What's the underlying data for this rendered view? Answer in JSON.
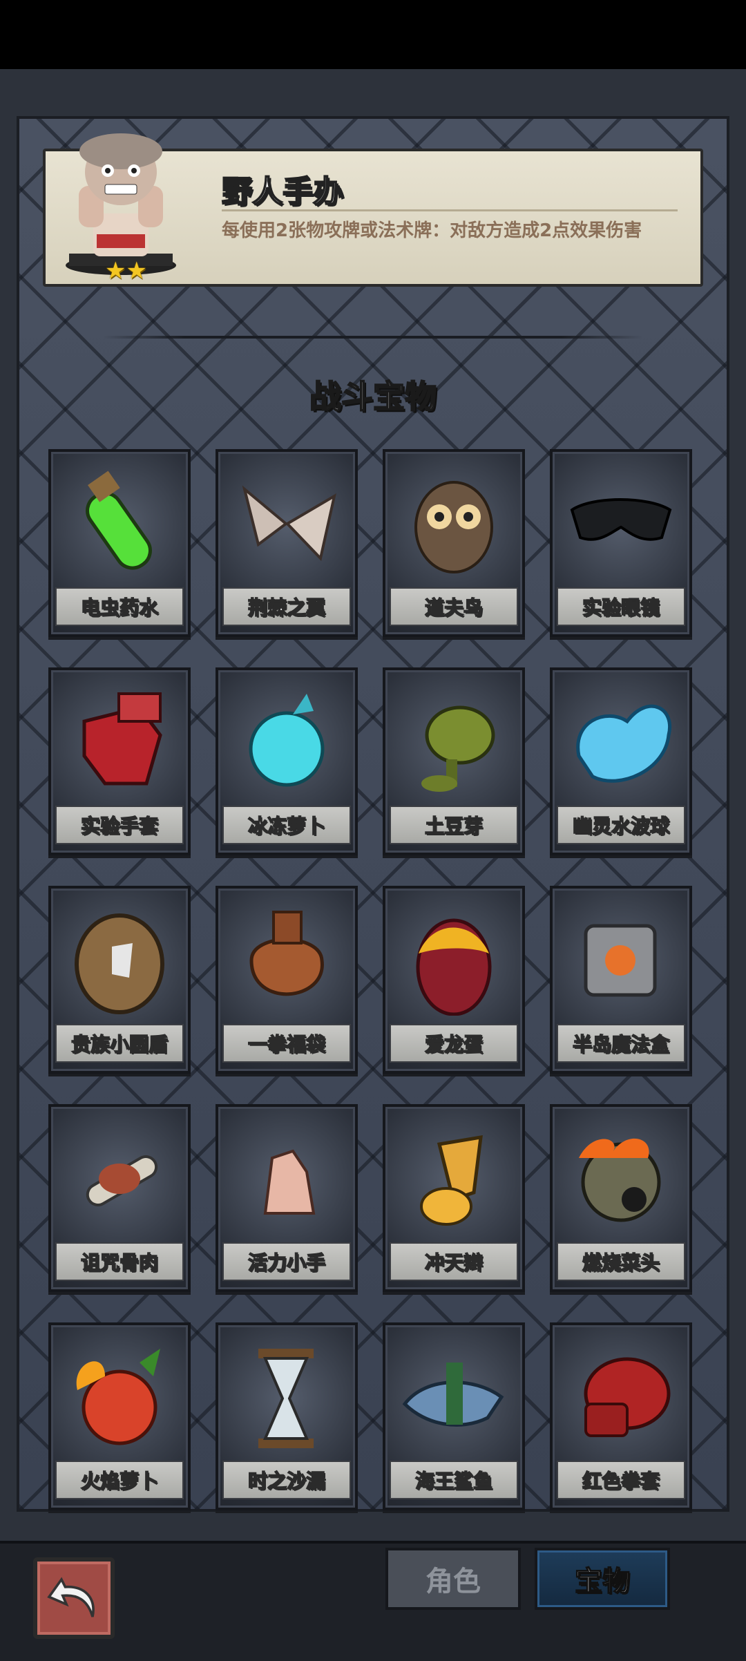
{
  "info": {
    "title": "野人手办",
    "description": "每使用2张物攻牌或法术牌：对敌方造成2点效果伤害",
    "stars": 2
  },
  "section_title": "战斗宝物",
  "items": [
    {
      "label": "电虫药水",
      "icon": "green-potion-vial"
    },
    {
      "label": "荆棘之翼",
      "icon": "thorn-wings"
    },
    {
      "label": "道夫鸟",
      "icon": "owl"
    },
    {
      "label": "实验眼镜",
      "icon": "black-goggles"
    },
    {
      "label": "实验手套",
      "icon": "red-glove"
    },
    {
      "label": "冰冻萝卜",
      "icon": "frozen-radish"
    },
    {
      "label": "土豆芽",
      "icon": "peashooter-plant"
    },
    {
      "label": "幽灵水波球",
      "icon": "water-blob"
    },
    {
      "label": "贵族小圆盾",
      "icon": "round-shield"
    },
    {
      "label": "一拳福袋",
      "icon": "fist-sack"
    },
    {
      "label": "爱龙蛋",
      "icon": "dragon-egg"
    },
    {
      "label": "半岛魔法盒",
      "icon": "magic-cube"
    },
    {
      "label": "诅咒骨肉",
      "icon": "bone-meat"
    },
    {
      "label": "活力小手",
      "icon": "little-hand"
    },
    {
      "label": "冲天辫",
      "icon": "ponytail"
    },
    {
      "label": "燃烧菜头",
      "icon": "burning-spiked-ball"
    },
    {
      "label": "火焰萝卜",
      "icon": "flaming-radish"
    },
    {
      "label": "时之沙漏",
      "icon": "hourglass"
    },
    {
      "label": "海王鲨鱼",
      "icon": "shark"
    },
    {
      "label": "红色拳套",
      "icon": "boxing-glove"
    }
  ],
  "tabs": {
    "role": "角色",
    "treasure": "宝物"
  },
  "colors": {
    "background": "#3d4554",
    "selected_tab": "#1e3c59",
    "star": "#f3c623"
  }
}
